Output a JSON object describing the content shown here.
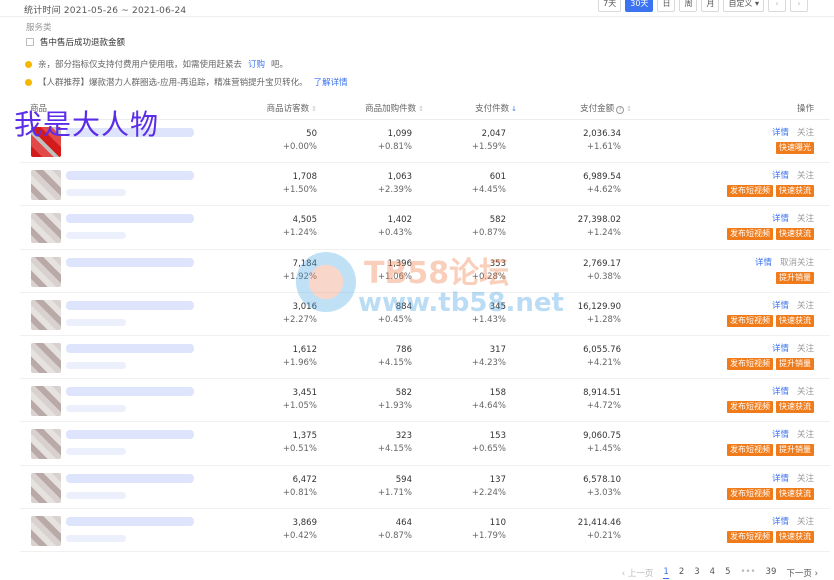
{
  "topbar": {
    "stat_text": "统计时间 2021-05-26 ~ 2021-06-24",
    "range_buttons": [
      "7天",
      "30天",
      "日",
      "周",
      "月",
      "自定义"
    ],
    "active_range": "30天"
  },
  "service": {
    "title": "服务类",
    "checkbox_label": "售中售后成功退款金额"
  },
  "notices": [
    {
      "text": "亲，部分指标仅支持付费用户使用哦，如需使用赶紧去",
      "link": "订购",
      "suffix": "吧。"
    },
    {
      "text": "【人群推荐】爆款潜力人群圈选-应用-再追踪，精准营销提升宝贝转化。",
      "link": "了解详情",
      "suffix": ""
    }
  ],
  "table": {
    "headers": [
      "商品",
      "商品访客数",
      "商品加购件数",
      "支付件数",
      "支付金额",
      "操作"
    ],
    "rows": [
      {
        "visitors": "50",
        "visitors_pct": "+0.00%",
        "cart": "1,099",
        "cart_pct": "+0.81%",
        "paid": "2,047",
        "paid_pct": "+1.59%",
        "amount": "2,036.34",
        "amount_pct": "+1.61%",
        "links": [
          "详情",
          "关注"
        ],
        "buttons": [
          "快速曝光"
        ]
      },
      {
        "visitors": "1,708",
        "visitors_pct": "+1.50%",
        "cart": "1,063",
        "cart_pct": "+2.39%",
        "paid": "601",
        "paid_pct": "+4.45%",
        "amount": "6,989.54",
        "amount_pct": "+4.62%",
        "links": [
          "详情",
          "关注"
        ],
        "buttons": [
          "发布短视频",
          "快速获流"
        ]
      },
      {
        "visitors": "4,505",
        "visitors_pct": "+1.24%",
        "cart": "1,402",
        "cart_pct": "+0.43%",
        "paid": "582",
        "paid_pct": "+0.87%",
        "amount": "27,398.02",
        "amount_pct": "+1.24%",
        "links": [
          "详情",
          "关注"
        ],
        "buttons": [
          "发布短视频",
          "快速获流"
        ]
      },
      {
        "visitors": "7,184",
        "visitors_pct": "+1.92%",
        "cart": "1,396",
        "cart_pct": "+1.06%",
        "paid": "353",
        "paid_pct": "+0.28%",
        "amount": "2,769.17",
        "amount_pct": "+0.38%",
        "links": [
          "详情",
          "取消关注"
        ],
        "buttons": [
          "提升销量"
        ]
      },
      {
        "visitors": "3,016",
        "visitors_pct": "+2.27%",
        "cart": "884",
        "cart_pct": "+0.45%",
        "paid": "345",
        "paid_pct": "+1.43%",
        "amount": "16,129.90",
        "amount_pct": "+1.28%",
        "links": [
          "详情",
          "关注"
        ],
        "buttons": [
          "发布短视频",
          "快速获流"
        ]
      },
      {
        "visitors": "1,612",
        "visitors_pct": "+1.96%",
        "cart": "786",
        "cart_pct": "+4.15%",
        "paid": "317",
        "paid_pct": "+4.23%",
        "amount": "6,055.76",
        "amount_pct": "+4.21%",
        "links": [
          "详情",
          "关注"
        ],
        "buttons": [
          "发布短视频",
          "提升销量"
        ]
      },
      {
        "visitors": "3,451",
        "visitors_pct": "+1.05%",
        "cart": "582",
        "cart_pct": "+1.93%",
        "paid": "158",
        "paid_pct": "+4.64%",
        "amount": "8,914.51",
        "amount_pct": "+4.72%",
        "links": [
          "详情",
          "关注"
        ],
        "buttons": [
          "发布短视频",
          "快速获流"
        ]
      },
      {
        "visitors": "1,375",
        "visitors_pct": "+0.51%",
        "cart": "323",
        "cart_pct": "+4.15%",
        "paid": "153",
        "paid_pct": "+0.65%",
        "amount": "9,060.75",
        "amount_pct": "+1.45%",
        "links": [
          "详情",
          "关注"
        ],
        "buttons": [
          "发布短视频",
          "提升销量"
        ]
      },
      {
        "visitors": "6,472",
        "visitors_pct": "+0.81%",
        "cart": "594",
        "cart_pct": "+1.71%",
        "paid": "137",
        "paid_pct": "+2.24%",
        "amount": "6,578.10",
        "amount_pct": "+3.03%",
        "links": [
          "详情",
          "关注"
        ],
        "buttons": [
          "发布短视频",
          "快速获流"
        ]
      },
      {
        "visitors": "3,869",
        "visitors_pct": "+0.42%",
        "cart": "464",
        "cart_pct": "+0.87%",
        "paid": "110",
        "paid_pct": "+1.79%",
        "amount": "21,414.46",
        "amount_pct": "+0.21%",
        "links": [
          "详情",
          "关注"
        ],
        "buttons": [
          "发布短视频",
          "快速获流"
        ]
      }
    ]
  },
  "overlay_label": "我是大人物",
  "watermark": {
    "line1": "TB58论坛",
    "line2": "www.tb58.net"
  },
  "pagination": {
    "prev": "上一页",
    "pages": [
      "1",
      "2",
      "3",
      "4",
      "5"
    ],
    "ellipsis": "•••",
    "last": "39",
    "next": "下一页",
    "current": "1"
  },
  "colors": {
    "accent": "#3b73f0",
    "orange": "#f07b1a",
    "overlay": "#5b2de8"
  }
}
